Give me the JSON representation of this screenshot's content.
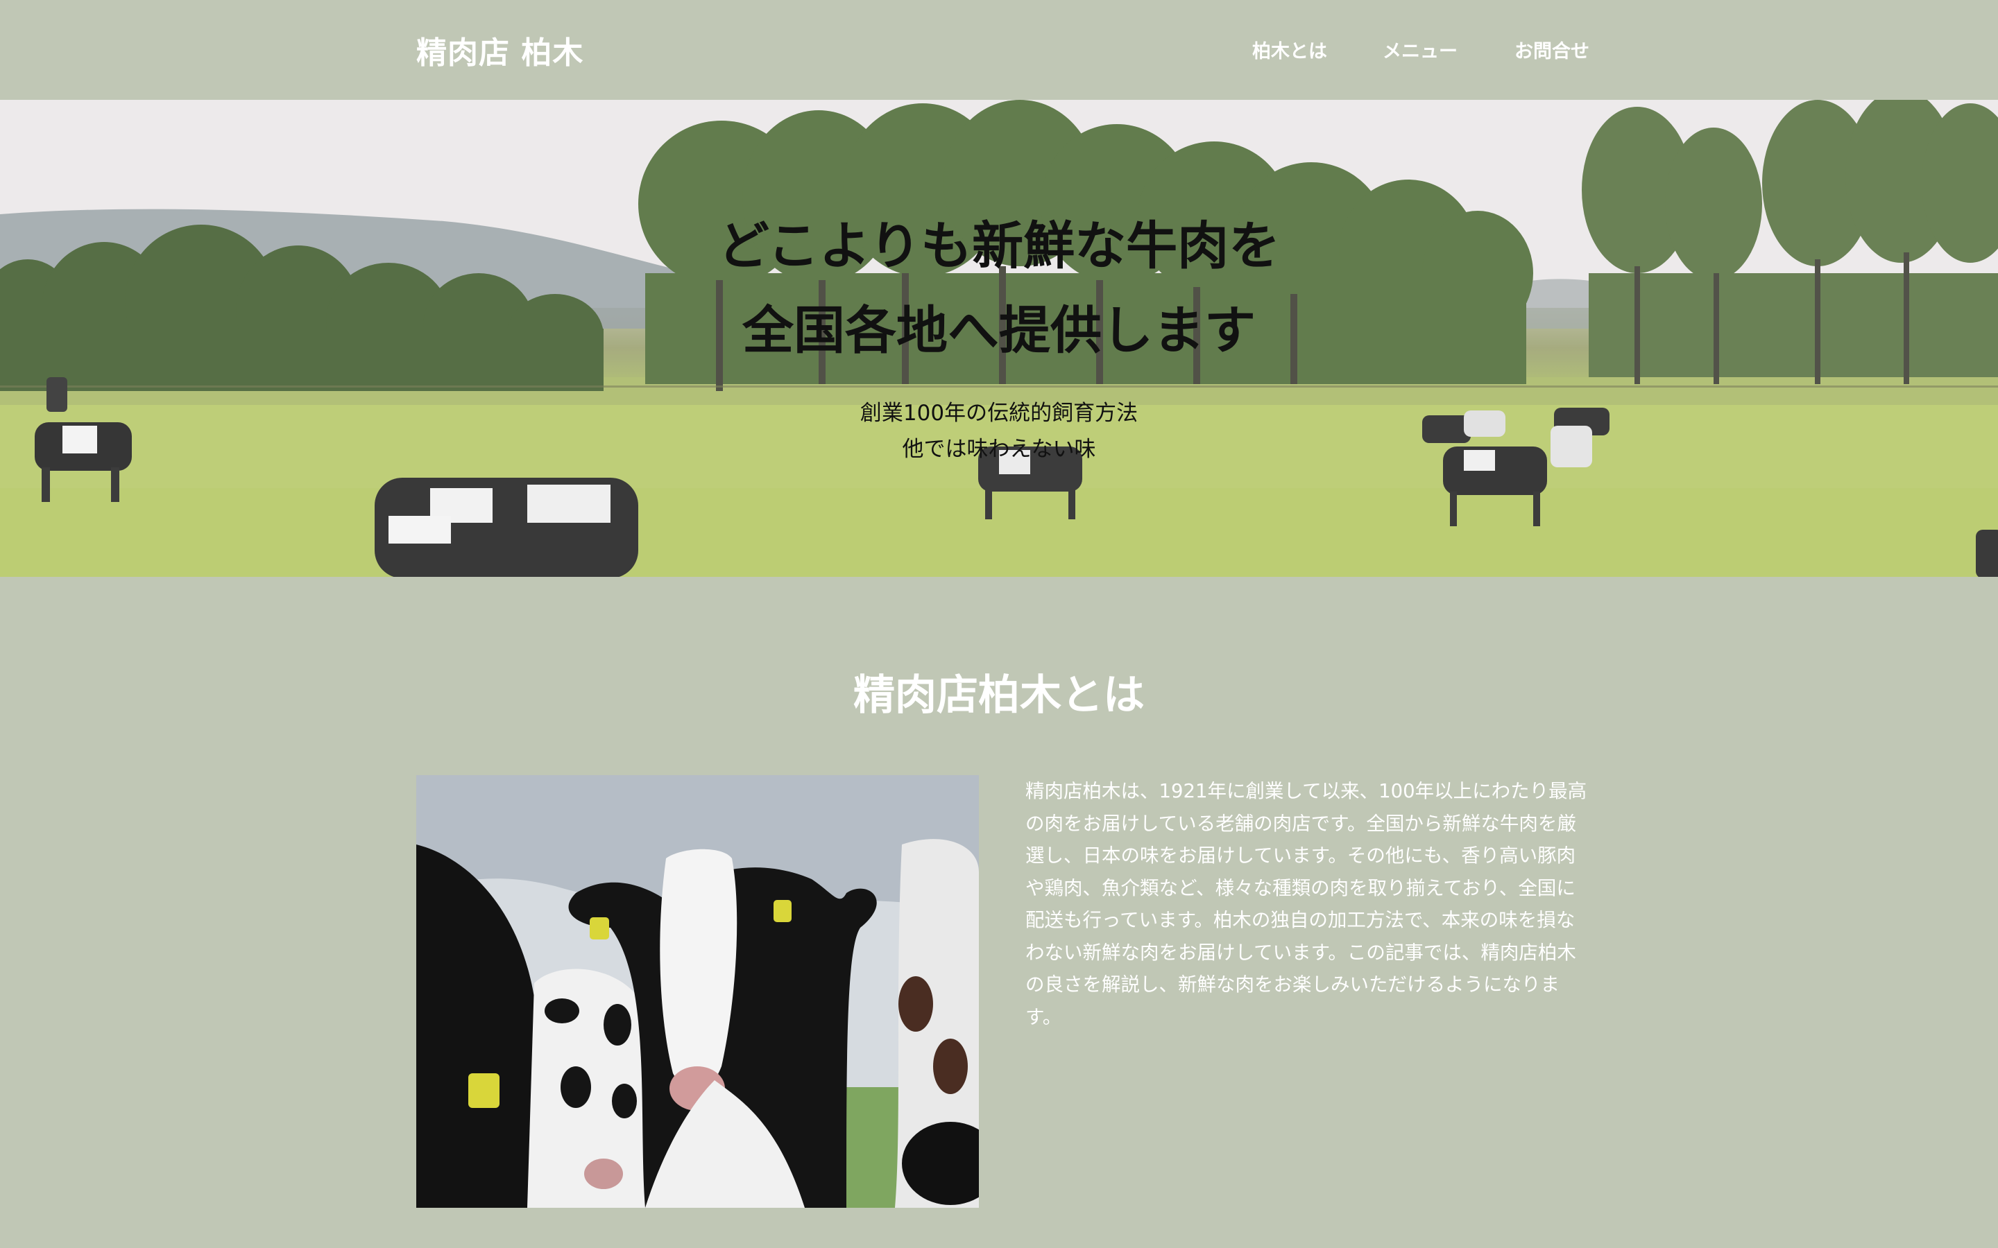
{
  "header": {
    "logo": "精肉店 柏木",
    "nav": [
      {
        "label": "柏木とは"
      },
      {
        "label": "メニュー"
      },
      {
        "label": "お問合せ"
      }
    ]
  },
  "hero": {
    "title_line1": "どこよりも新鮮な牛肉を",
    "title_line2": "全国各地へ提供します",
    "sub_line1": "創業100年の伝統的飼育方法",
    "sub_line2": "他では味わえない味"
  },
  "about": {
    "heading": "精肉店柏木とは",
    "body": "精肉店柏木は、1921年に創業して以来、100年以上にわたり最高の肉をお届けしている老舗の肉店です。全国から新鮮な牛肉を厳選し、日本の味をお届けしています。その他にも、香り高い豚肉や鶏肉、魚介類など、様々な種類の肉を取り揃えており、全国に配送も行っています。柏木の独自の加工方法で、本来の味を損なわない新鮮な肉をお届けしています。この記事では、精肉店柏木の良さを解説し、新鮮な肉をお楽しみいただけるようになります。"
  },
  "colors": {
    "background": "#c0c7b5",
    "header_text": "#ffffff",
    "hero_text": "#111111"
  }
}
